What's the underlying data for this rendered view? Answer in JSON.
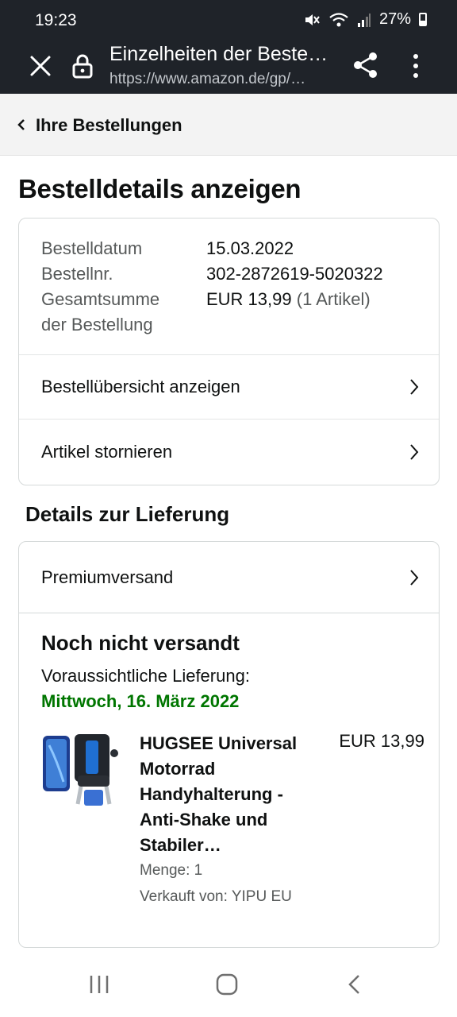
{
  "status_bar": {
    "time": "19:23",
    "battery": "27%",
    "icons": [
      "mute-icon",
      "wifi-icon",
      "signal-icon",
      "battery-icon"
    ]
  },
  "browser": {
    "title": "Einzelheiten der Beste…",
    "url": "https://www.amazon.de/gp/…",
    "icons": [
      "close-icon",
      "lock-icon",
      "share-icon",
      "more-vert-icon"
    ]
  },
  "nav": {
    "back_label": "Ihre Bestellungen"
  },
  "page": {
    "title": "Bestelldetails anzeigen"
  },
  "summary": {
    "date_label": "Bestelldatum",
    "date_value": "15.03.2022",
    "order_no_label": "Bestellnr.",
    "order_no_value": "302-2872619-5020322",
    "total_label_1": "Gesamtsumme",
    "total_label_2": "der Bestellung",
    "total_value": "EUR 13,99",
    "total_items": "(1 Artikel)",
    "links": [
      "Bestellübersicht anzeigen",
      "Artikel stornieren"
    ]
  },
  "delivery": {
    "section_title": "Details zur Lieferung",
    "shipping_method": "Premiumversand",
    "status": "Noch nicht versandt",
    "eta_label": "Voraussichtliche Lieferung:",
    "eta_date": "Mittwoch, 16. März 2022",
    "accent_color": "#007600"
  },
  "product": {
    "title": "HUGSEE Universal Motorrad Handyhalterung - Anti-Shake und Stabiler…",
    "price": "EUR 13,99",
    "quantity": "Menge: 1",
    "seller": "Verkauft von: YIPU EU"
  },
  "system_nav": {
    "icons": [
      "recent-apps-icon",
      "home-icon",
      "back-icon"
    ]
  }
}
